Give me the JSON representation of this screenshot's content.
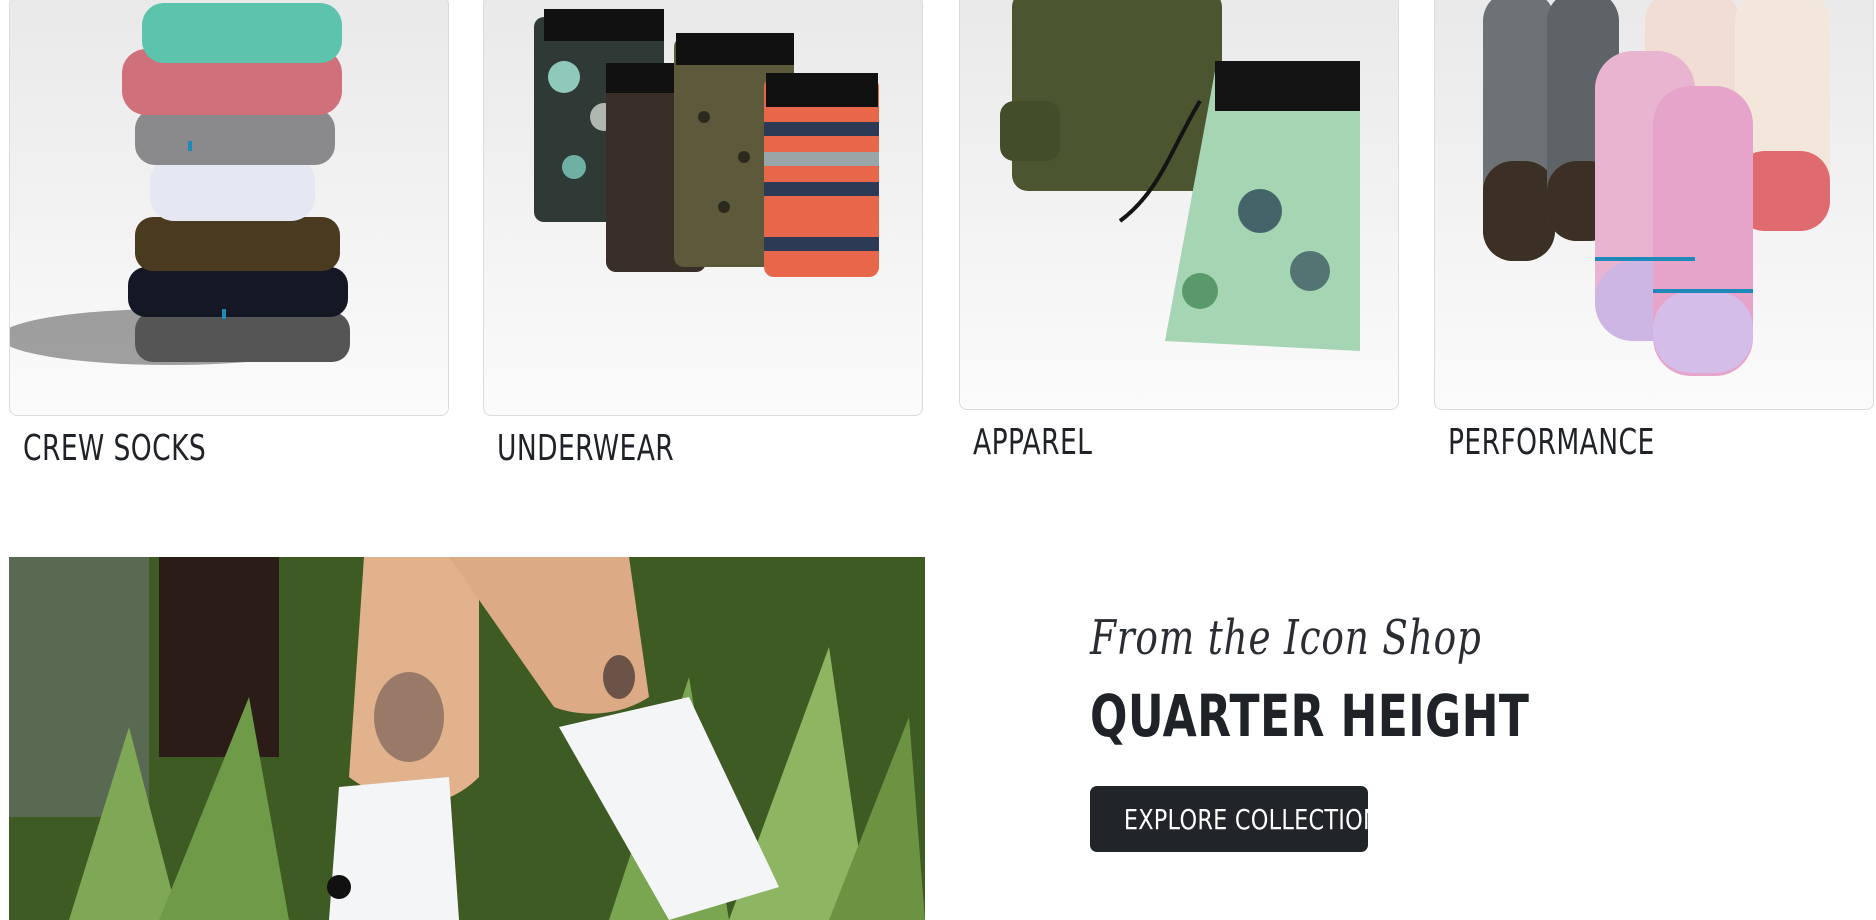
{
  "categories": [
    {
      "label": "CREW SOCKS"
    },
    {
      "label": "UNDERWEAR"
    },
    {
      "label": "APPAREL"
    },
    {
      "label": "PERFORMANCE"
    }
  ],
  "promo": {
    "eyebrow": "From the Icon Shop",
    "title": "QUARTER HEIGHT",
    "button_label": "EXPLORE COLLECTIONS"
  },
  "colors": {
    "text": "#1f2328",
    "button_bg": "#212529",
    "button_text": "#ffffff",
    "card_border": "#dcdcdc"
  }
}
